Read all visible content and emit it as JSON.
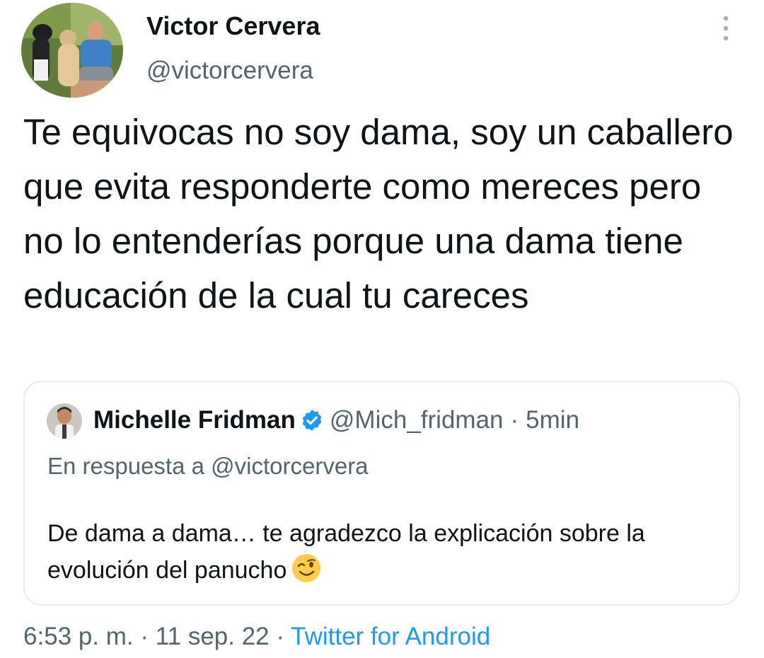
{
  "author": {
    "name": "Victor Cervera",
    "handle": "@victorcervera"
  },
  "tweet": {
    "text": "Te equivocas no soy dama, soy un caballero que evita responderte como mereces pero no lo entenderías porque una dama tiene educación de la cual tu careces"
  },
  "quoted": {
    "name": "Michelle Fridman",
    "handle": "@Mich_fridman",
    "separator": "·",
    "time": "5min",
    "reply_prefix": "En respuesta a",
    "reply_to": "@victorcervera",
    "text": "De dama a dama… te agradezco la explicación sobre la evolución del panucho",
    "emoji": "winking-face"
  },
  "meta": {
    "time": "6:53 p. m.",
    "sep1": "·",
    "date": "11 sep. 22",
    "sep2": "·",
    "source": "Twitter for Android"
  },
  "colors": {
    "accent": "#1d9bf0",
    "secondary_text": "#536471",
    "primary_text": "#0f1419",
    "border": "#e6ecf0"
  },
  "icons": {
    "more": "more-vertical-icon",
    "verified": "verified-badge-icon"
  }
}
